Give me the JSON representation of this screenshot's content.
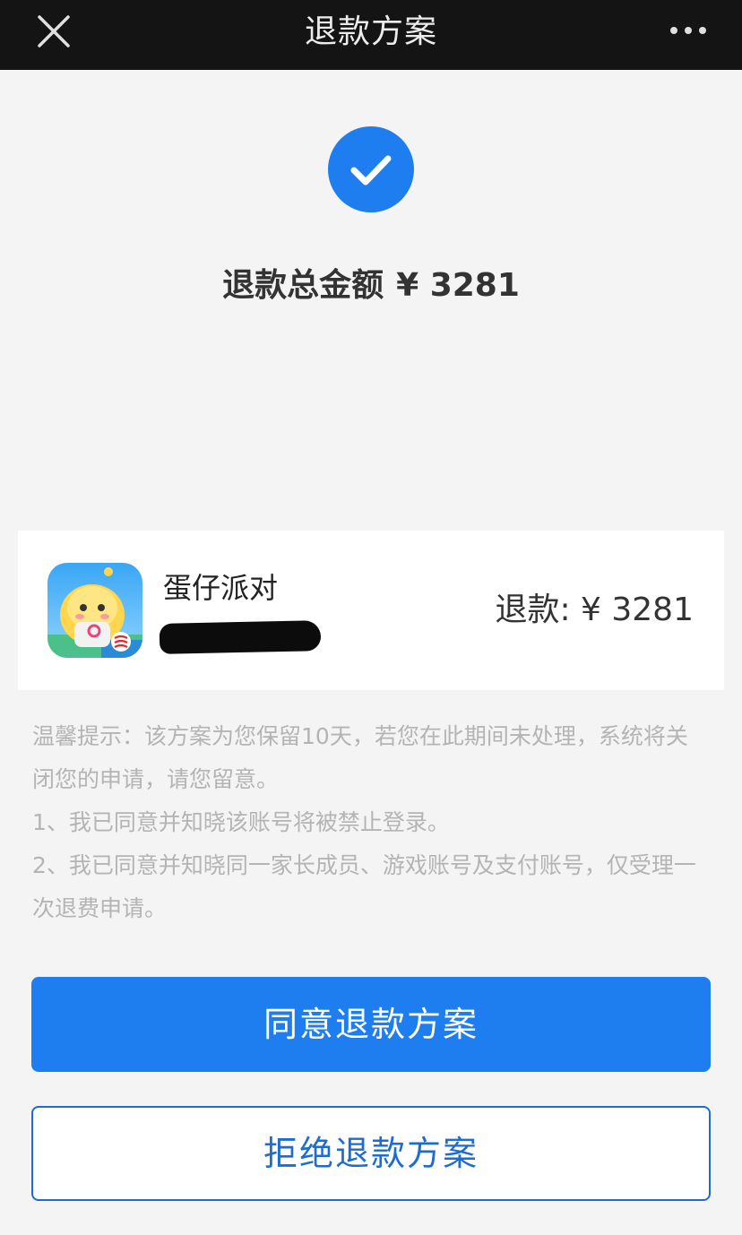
{
  "topbar": {
    "title": "退款方案",
    "close_icon": "close-icon",
    "more_icon": "more-dots-icon"
  },
  "status": {
    "icon": "check-icon",
    "total_label": "退款总金额",
    "total_amount": "¥ 3281"
  },
  "order": {
    "app_icon": "game-app-icon",
    "app_name": "蛋仔派对",
    "refund_text": "退款: ¥ 3281"
  },
  "notes": {
    "lines": [
      "温馨提示：该方案为您保留10天，若您在此期间未处理，系统将关闭您的申请，请您留意。",
      "1、我已同意并知晓该账号将被禁止登录。",
      "2、我已同意并知晓同一家长成员、游戏账号及支付账号，仅受理一次退费申请。"
    ]
  },
  "buttons": {
    "agree_label": "同意退款方案",
    "reject_label": "拒绝退款方案"
  },
  "colors": {
    "accent": "#1e7ef0",
    "topbar": "#141414",
    "background": "#f4f4f4"
  }
}
